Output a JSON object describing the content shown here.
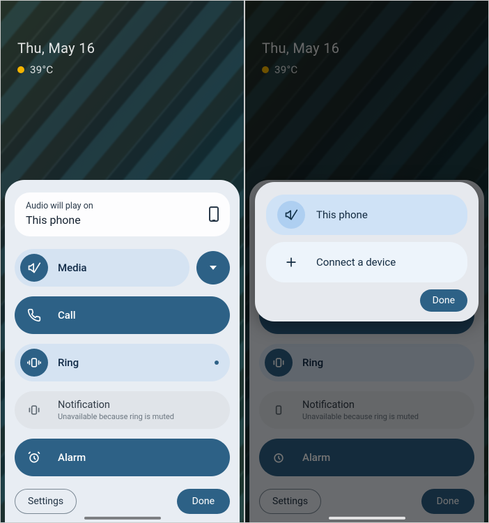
{
  "status": {
    "date": "Thu, May 16",
    "temp": "39°C"
  },
  "panel": {
    "output_title": "Audio will play on",
    "output_value": "This phone",
    "sliders": {
      "media": "Media",
      "call": "Call",
      "ring": "Ring",
      "notif_title": "Notification",
      "notif_sub": "Unavailable because ring is muted",
      "alarm": "Alarm"
    },
    "settings": "Settings",
    "done": "Done"
  },
  "popup": {
    "this_phone": "This phone",
    "connect": "Connect a device",
    "done": "Done"
  }
}
